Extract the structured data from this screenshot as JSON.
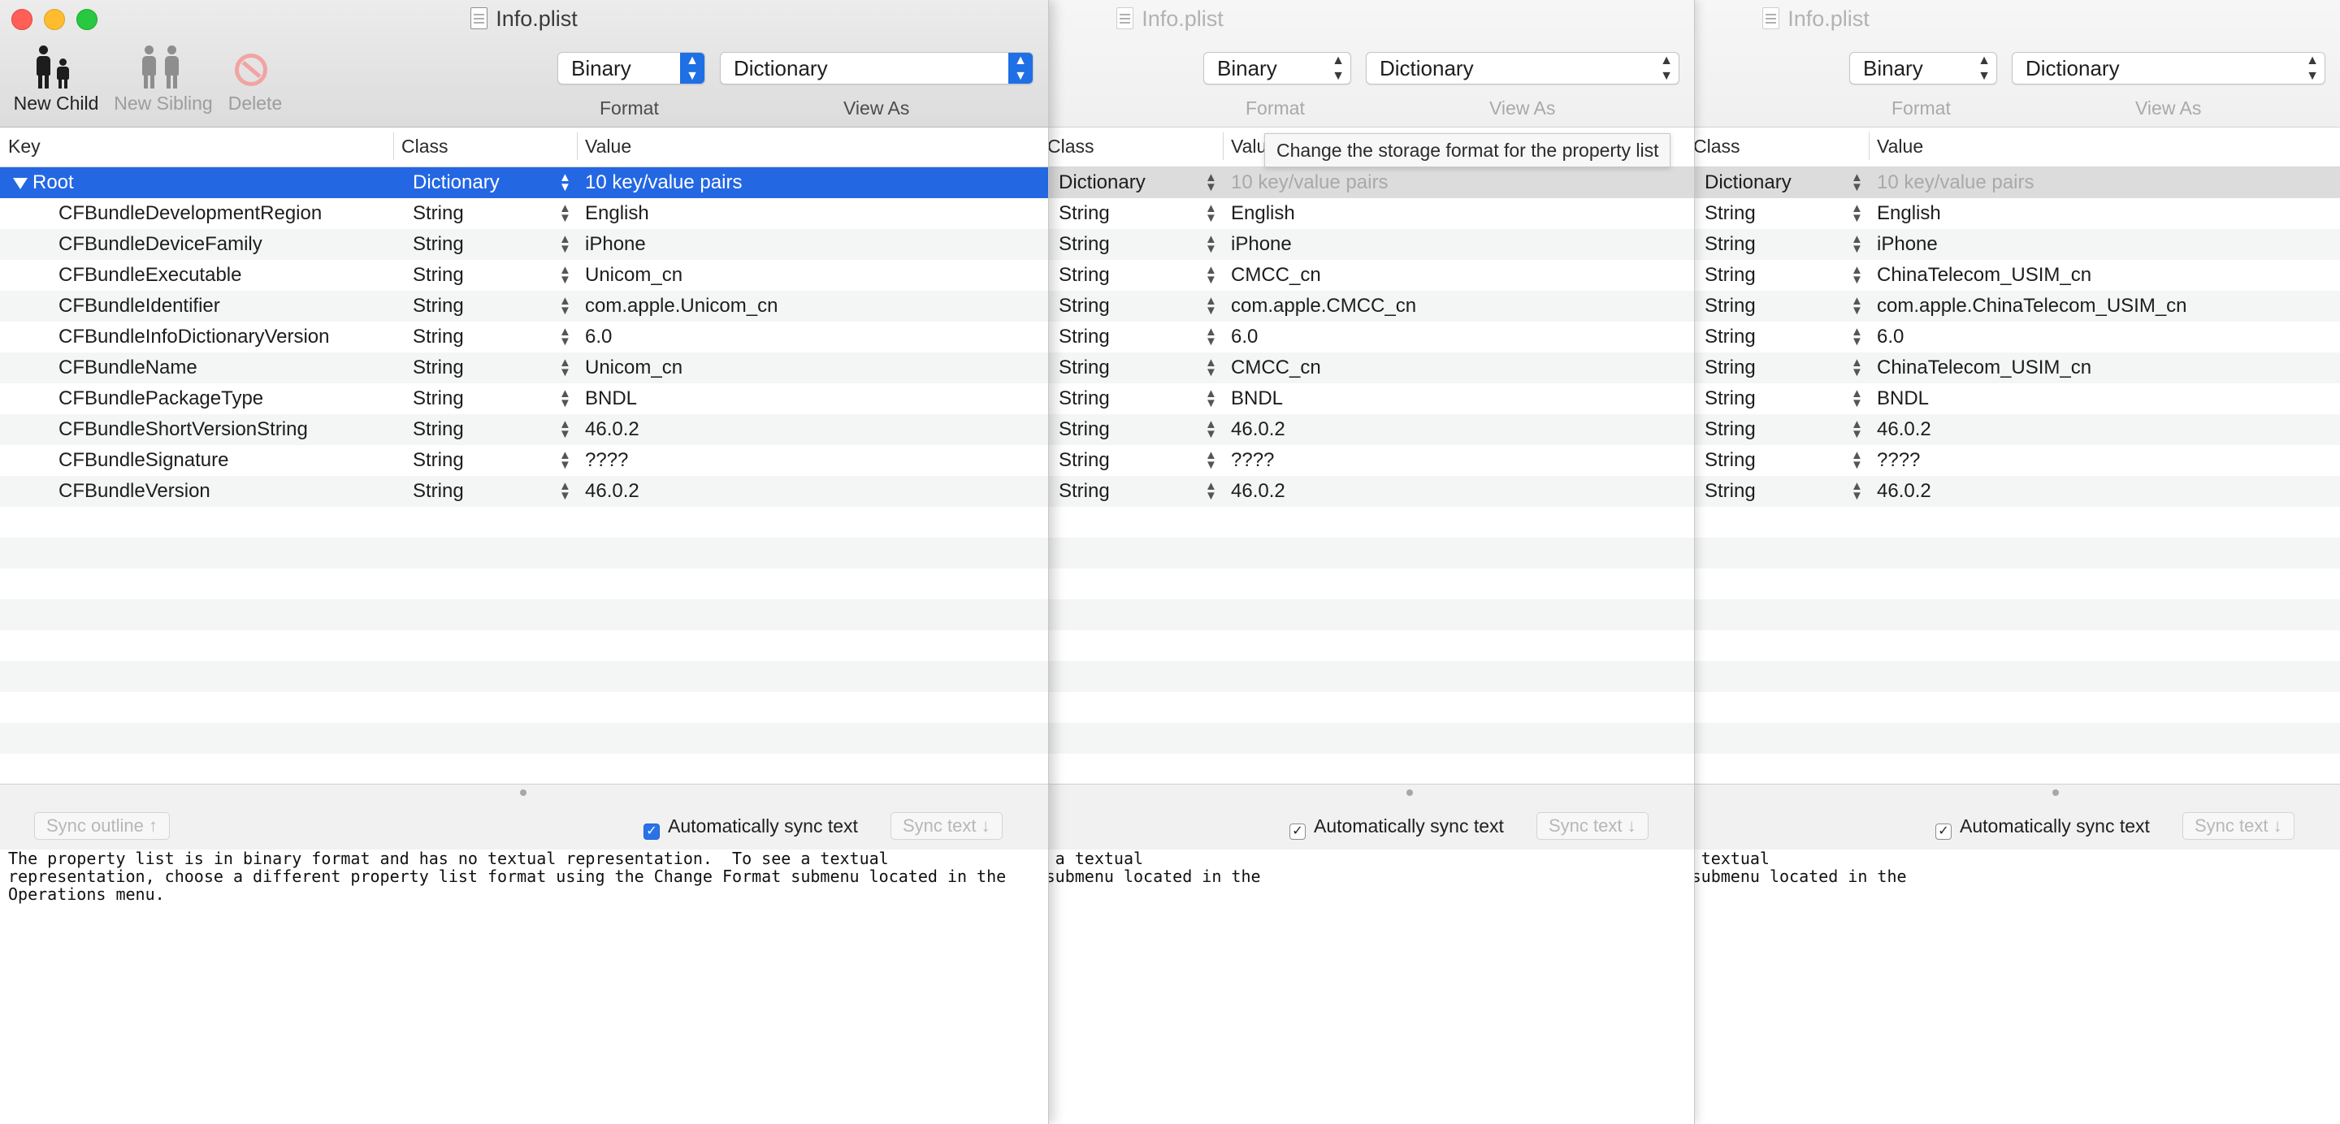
{
  "windows": [
    {
      "title": "Info.plist",
      "toolbar": {
        "new_child": "New Child",
        "new_sibling": "New Sibling",
        "delete": "Delete"
      },
      "format": {
        "value": "Binary",
        "label": "Format"
      },
      "view_as": {
        "value": "Dictionary",
        "label": "View As"
      },
      "columns": {
        "key": "Key",
        "class": "Class",
        "value": "Value"
      },
      "root": {
        "key": "Root",
        "class": "Dictionary",
        "value": "10 key/value pairs"
      },
      "rows": [
        {
          "key": "CFBundleDevelopmentRegion",
          "class": "String",
          "value": "English"
        },
        {
          "key": "CFBundleDeviceFamily",
          "class": "String",
          "value": "iPhone"
        },
        {
          "key": "CFBundleExecutable",
          "class": "String",
          "value": "Unicom_cn"
        },
        {
          "key": "CFBundleIdentifier",
          "class": "String",
          "value": "com.apple.Unicom_cn"
        },
        {
          "key": "CFBundleInfoDictionaryVersion",
          "class": "String",
          "value": "6.0"
        },
        {
          "key": "CFBundleName",
          "class": "String",
          "value": "Unicom_cn"
        },
        {
          "key": "CFBundlePackageType",
          "class": "String",
          "value": "BNDL"
        },
        {
          "key": "CFBundleShortVersionString",
          "class": "String",
          "value": "46.0.2"
        },
        {
          "key": "CFBundleSignature",
          "class": "String",
          "value": "????"
        },
        {
          "key": "CFBundleVersion",
          "class": "String",
          "value": "46.0.2"
        }
      ],
      "sync_outline": "Sync outline ↑",
      "auto_sync": "Automatically sync text",
      "sync_text": "Sync text ↓",
      "text": "The property list is in binary format and has no textual representation.  To see a textual\nrepresentation, choose a different property list format using the Change Format submenu located in the\nOperations menu."
    },
    {
      "title": "Info.plist",
      "format": {
        "value": "Binary",
        "label": "Format"
      },
      "view_as": {
        "value": "Dictionary",
        "label": "View As"
      },
      "columns": {
        "class": "Class",
        "value": "Valu"
      },
      "root": {
        "class": "Dictionary",
        "value": "10 key/value pairs"
      },
      "rows": [
        {
          "class": "String",
          "value": "English"
        },
        {
          "class": "String",
          "value": "iPhone"
        },
        {
          "class": "String",
          "value": "CMCC_cn"
        },
        {
          "class": "String",
          "value": "com.apple.CMCC_cn"
        },
        {
          "class": "String",
          "value": "6.0"
        },
        {
          "class": "String",
          "value": "CMCC_cn"
        },
        {
          "class": "String",
          "value": "BNDL"
        },
        {
          "class": "String",
          "value": "46.0.2"
        },
        {
          "class": "String",
          "value": "????"
        },
        {
          "class": "String",
          "value": "46.0.2"
        }
      ],
      "auto_sync": "Automatically sync text",
      "sync_text": "Sync text ↓",
      "text": "d has no textual representation.  To see a textual\nrty list format using the Change Format submenu located in the"
    },
    {
      "title": "Info.plist",
      "format": {
        "value": "Binary",
        "label": "Format"
      },
      "view_as": {
        "value": "Dictionary",
        "label": "View As"
      },
      "columns": {
        "class": "Class",
        "value": "Value"
      },
      "root": {
        "class": "Dictionary",
        "value": "10 key/value pairs"
      },
      "rows": [
        {
          "class": "String",
          "value": "English"
        },
        {
          "class": "String",
          "value": "iPhone"
        },
        {
          "class": "String",
          "value": "ChinaTelecom_USIM_cn"
        },
        {
          "class": "String",
          "value": "com.apple.ChinaTelecom_USIM_cn"
        },
        {
          "class": "String",
          "value": "6.0"
        },
        {
          "class": "String",
          "value": "ChinaTelecom_USIM_cn"
        },
        {
          "class": "String",
          "value": "BNDL"
        },
        {
          "class": "String",
          "value": "46.0.2"
        },
        {
          "class": "String",
          "value": "????"
        },
        {
          "class": "String",
          "value": "46.0.2"
        }
      ],
      "auto_sync": "Automatically sync text",
      "sync_text": "Sync text ↓",
      "text": "has no textual representation.  To see a textual\nrty list format using the Change Format submenu located in the"
    }
  ],
  "tooltip": "Change the storage format for the property list",
  "colors": {
    "selection": "#2367e3",
    "accent": "#1f6fe5"
  }
}
